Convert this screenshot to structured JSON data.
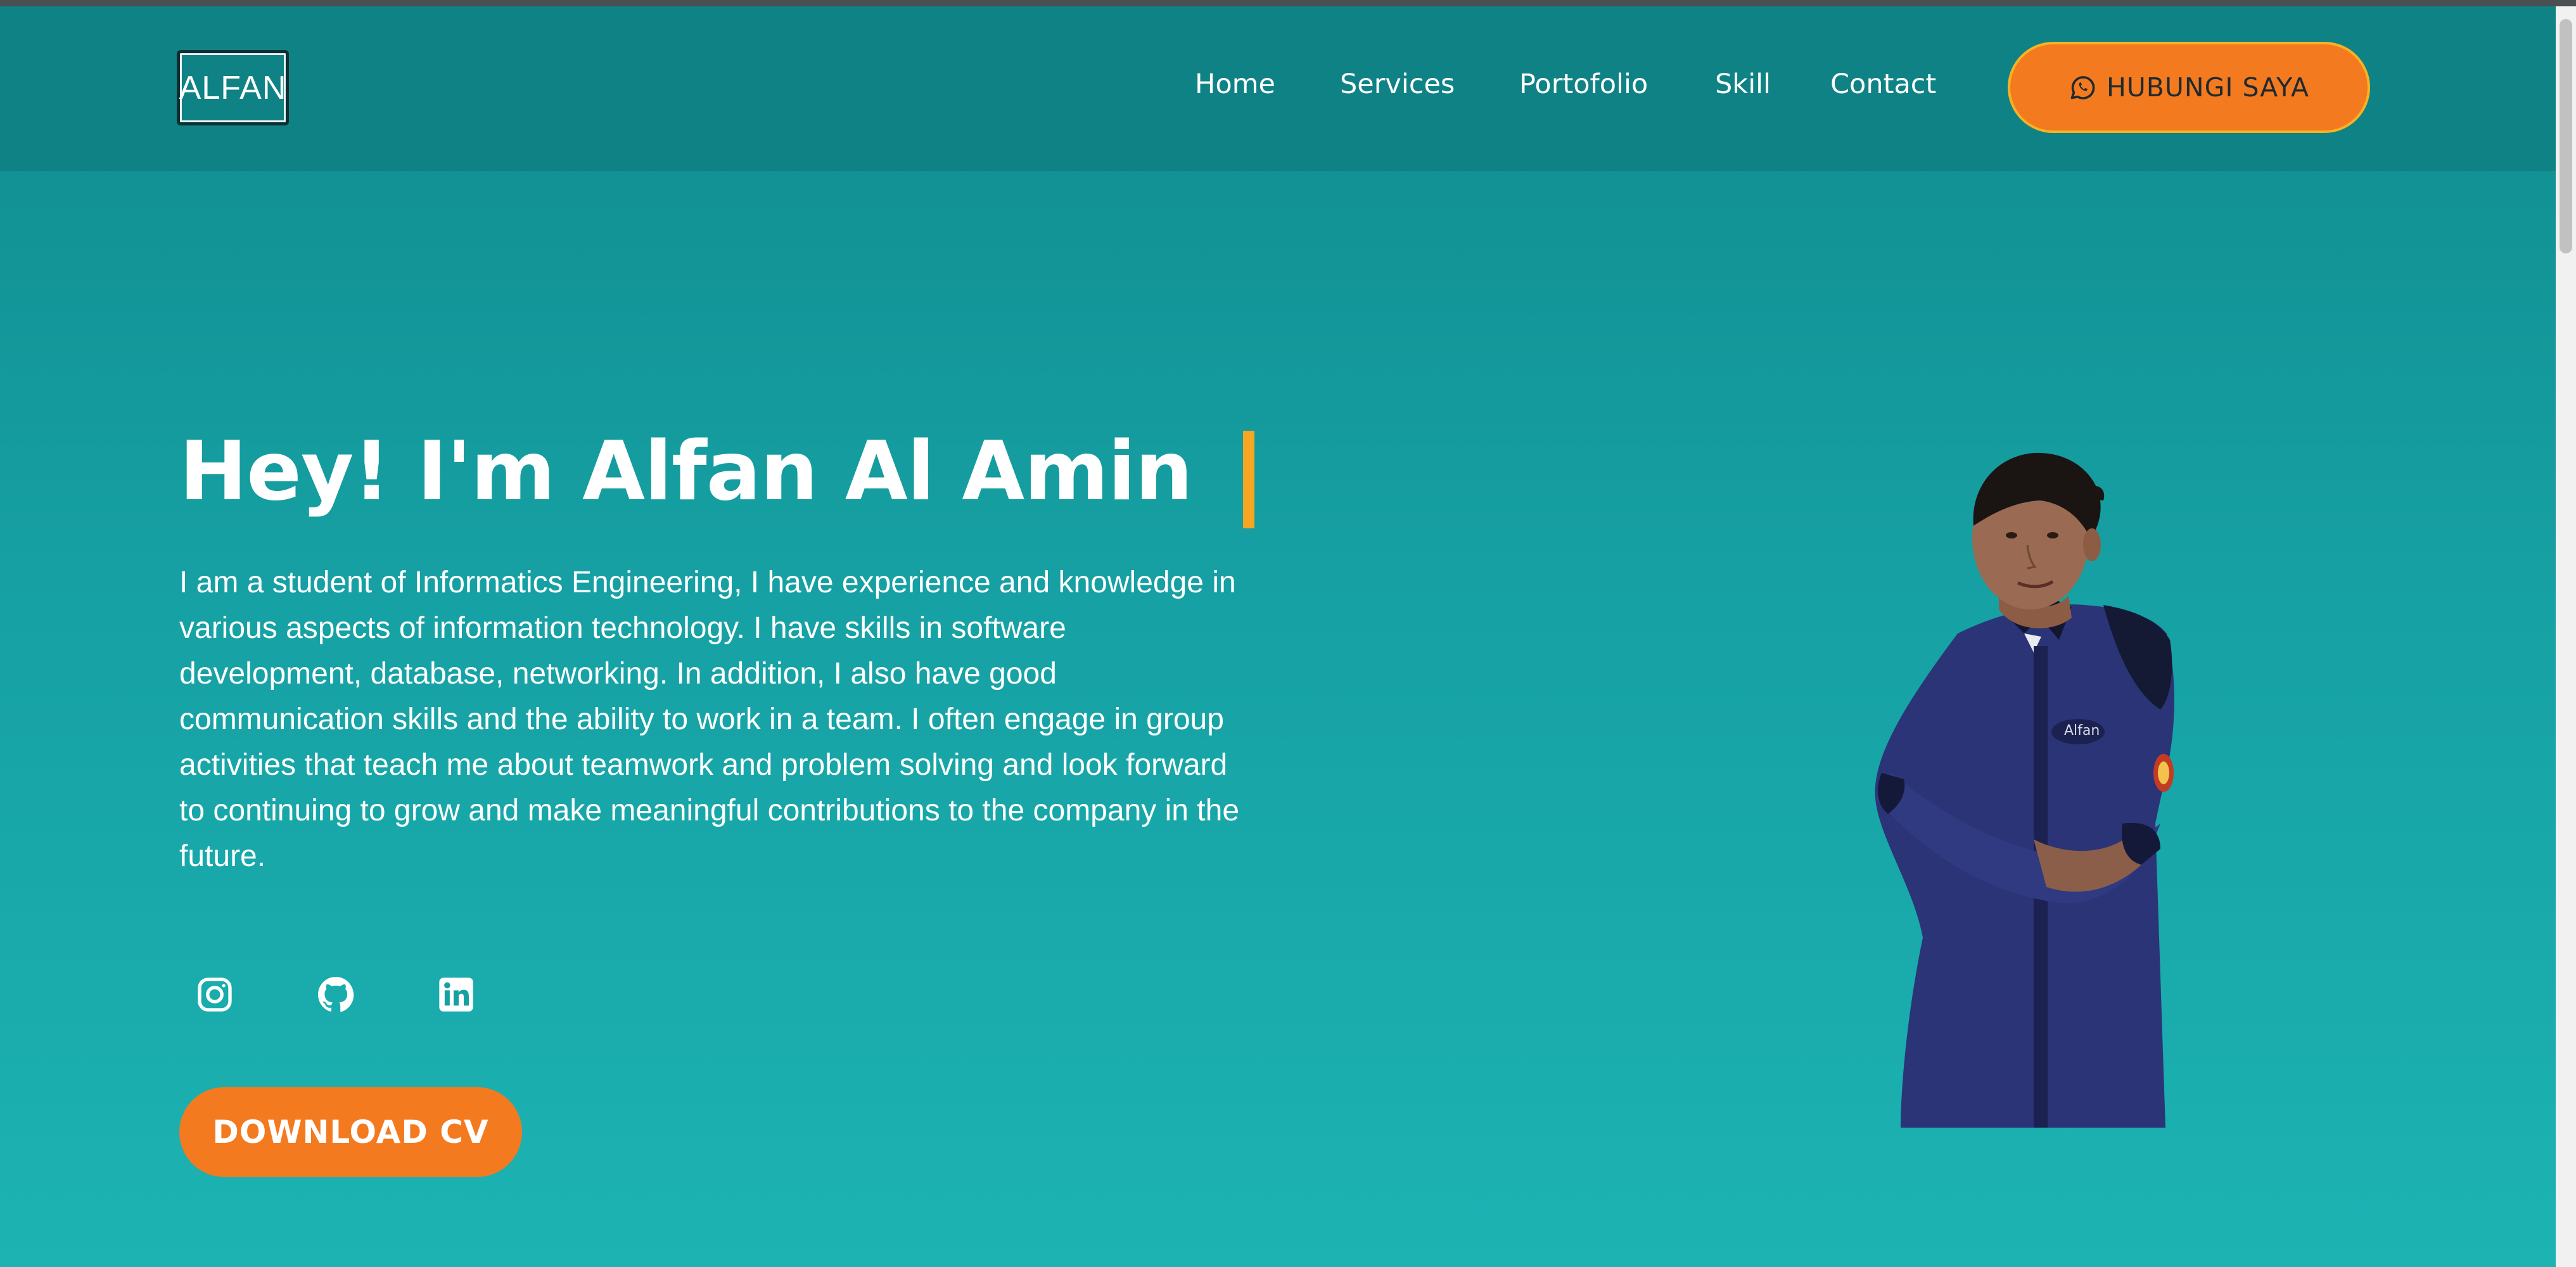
{
  "header": {
    "logo_text": "ALFAN",
    "nav": [
      {
        "label": "Home"
      },
      {
        "label": "Services"
      },
      {
        "label": "Portofolio"
      },
      {
        "label": "Skill"
      },
      {
        "label": "Contact"
      }
    ],
    "cta_label": "HUBUNGI SAYA",
    "cta_icon": "whatsapp-icon"
  },
  "hero": {
    "title": "Hey! I'm Alfan Al Amin",
    "description": "I am a student of Informatics Engineering, I have experience and knowledge in various aspects of information technology. I have skills in software development, database, networking. In addition, I also have good communication skills and the ability to work in a team. I often engage in group activities that teach me about teamwork and problem solving and look forward to continuing to grow and make meaningful contributions to the company in the future.",
    "social_icons": [
      "instagram-icon",
      "github-icon",
      "linkedin-icon"
    ],
    "download_label": "DOWNLOAD CV",
    "portrait_shirt_text": "Alfan"
  },
  "colors": {
    "accent_orange": "#f47a1f",
    "cursor_yellow": "#f5a623",
    "nav_bg": "#0f8285",
    "hero_bg_top": "#108b8d",
    "hero_bg_bottom": "#1db3b3"
  }
}
